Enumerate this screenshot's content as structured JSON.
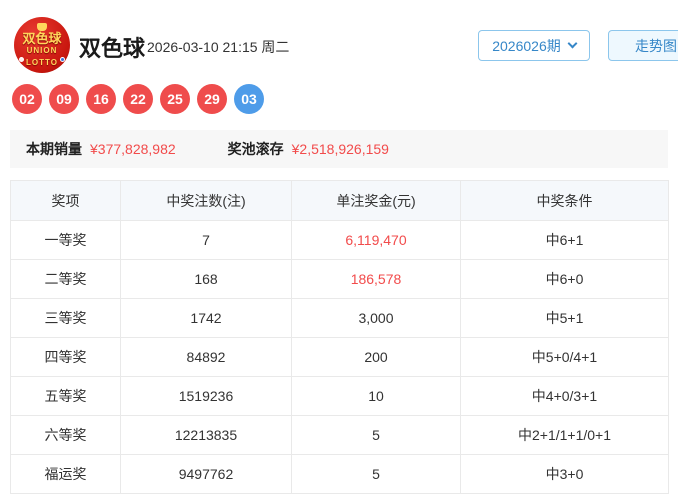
{
  "header": {
    "logo": {
      "line_cn": "双色球",
      "line_en1": "UNION",
      "line_en2": "LOTTO"
    },
    "title": "双色球",
    "datetime": "2026-03-10 21:15 周二",
    "issue_selector_label": "2026026期",
    "trend_button_label": "走势图"
  },
  "balls": {
    "red": [
      "02",
      "09",
      "16",
      "22",
      "25",
      "29"
    ],
    "blue": [
      "03"
    ]
  },
  "summary": {
    "sales_label": "本期销量",
    "sales_value": "¥377,828,982",
    "pool_label": "奖池滚存",
    "pool_value": "¥2,518,926,159"
  },
  "table": {
    "headers": [
      "奖项",
      "中奖注数(注)",
      "单注奖金(元)",
      "中奖条件"
    ],
    "rows": [
      {
        "prize": "一等奖",
        "count": "7",
        "amount": "6,119,470",
        "condition": "中6+1",
        "highlight": true
      },
      {
        "prize": "二等奖",
        "count": "168",
        "amount": "186,578",
        "condition": "中6+0",
        "highlight": true
      },
      {
        "prize": "三等奖",
        "count": "1742",
        "amount": "3,000",
        "condition": "中5+1",
        "highlight": false
      },
      {
        "prize": "四等奖",
        "count": "84892",
        "amount": "200",
        "condition": "中5+0/4+1",
        "highlight": false
      },
      {
        "prize": "五等奖",
        "count": "1519236",
        "amount": "10",
        "condition": "中4+0/3+1",
        "highlight": false
      },
      {
        "prize": "六等奖",
        "count": "12213835",
        "amount": "5",
        "condition": "中2+1/1+1/0+1",
        "highlight": false
      },
      {
        "prize": "福运奖",
        "count": "9497762",
        "amount": "5",
        "condition": "中3+0",
        "highlight": false
      }
    ]
  },
  "colors": {
    "red_ball": "#ef4c4c",
    "blue_ball": "#4e9ce9",
    "accent_red": "#f24b4b",
    "accent_blue": "#3687c8",
    "header_bg": "#f5f8fb",
    "banner_bg": "#f7f7f7",
    "border": "#e9e9e9"
  }
}
